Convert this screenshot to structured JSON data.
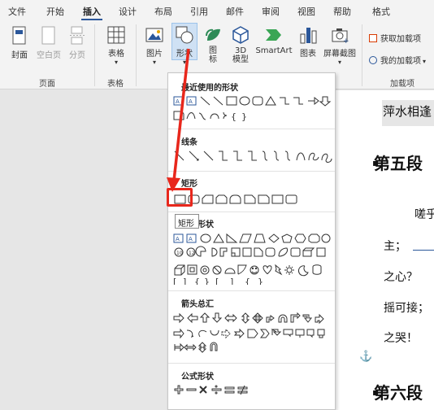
{
  "tabs": [
    "文件",
    "开始",
    "插入",
    "设计",
    "布局",
    "引用",
    "邮件",
    "审阅",
    "视图",
    "帮助",
    "格式"
  ],
  "active_tab": "插入",
  "ribbon": {
    "pages": {
      "cover": "封面",
      "blank": "空白页",
      "break": "分页",
      "group": "页面"
    },
    "table": {
      "label": "表格",
      "group": "表格"
    },
    "illustrations": {
      "picture": "图片",
      "shapes": "形状",
      "icons": "图\n标",
      "model": "3D\n模型",
      "smartart": "SmartArt",
      "chart": "图表",
      "screenshot": "屏幕截图"
    },
    "addins": {
      "get": "获取加载项",
      "my": "我的加载项",
      "group": "加载项"
    }
  },
  "dropdown": {
    "sections": {
      "recent": "最近使用的形状",
      "lines": "线条",
      "rect": "矩形",
      "basic": "基本形状",
      "arrows": "箭头总汇",
      "equation": "公式形状"
    },
    "tooltip": "矩形"
  },
  "document": {
    "line1": "萍水相逢",
    "heading5": "第五段",
    "p1": "嗟乎",
    "p2": "主；",
    "p3": "之心？",
    "p4": "摇可接；",
    "p5": "之哭！",
    "heading6": "第六段"
  },
  "colors": {
    "accent": "#2b579a",
    "annotation_red": "#e8271c"
  }
}
